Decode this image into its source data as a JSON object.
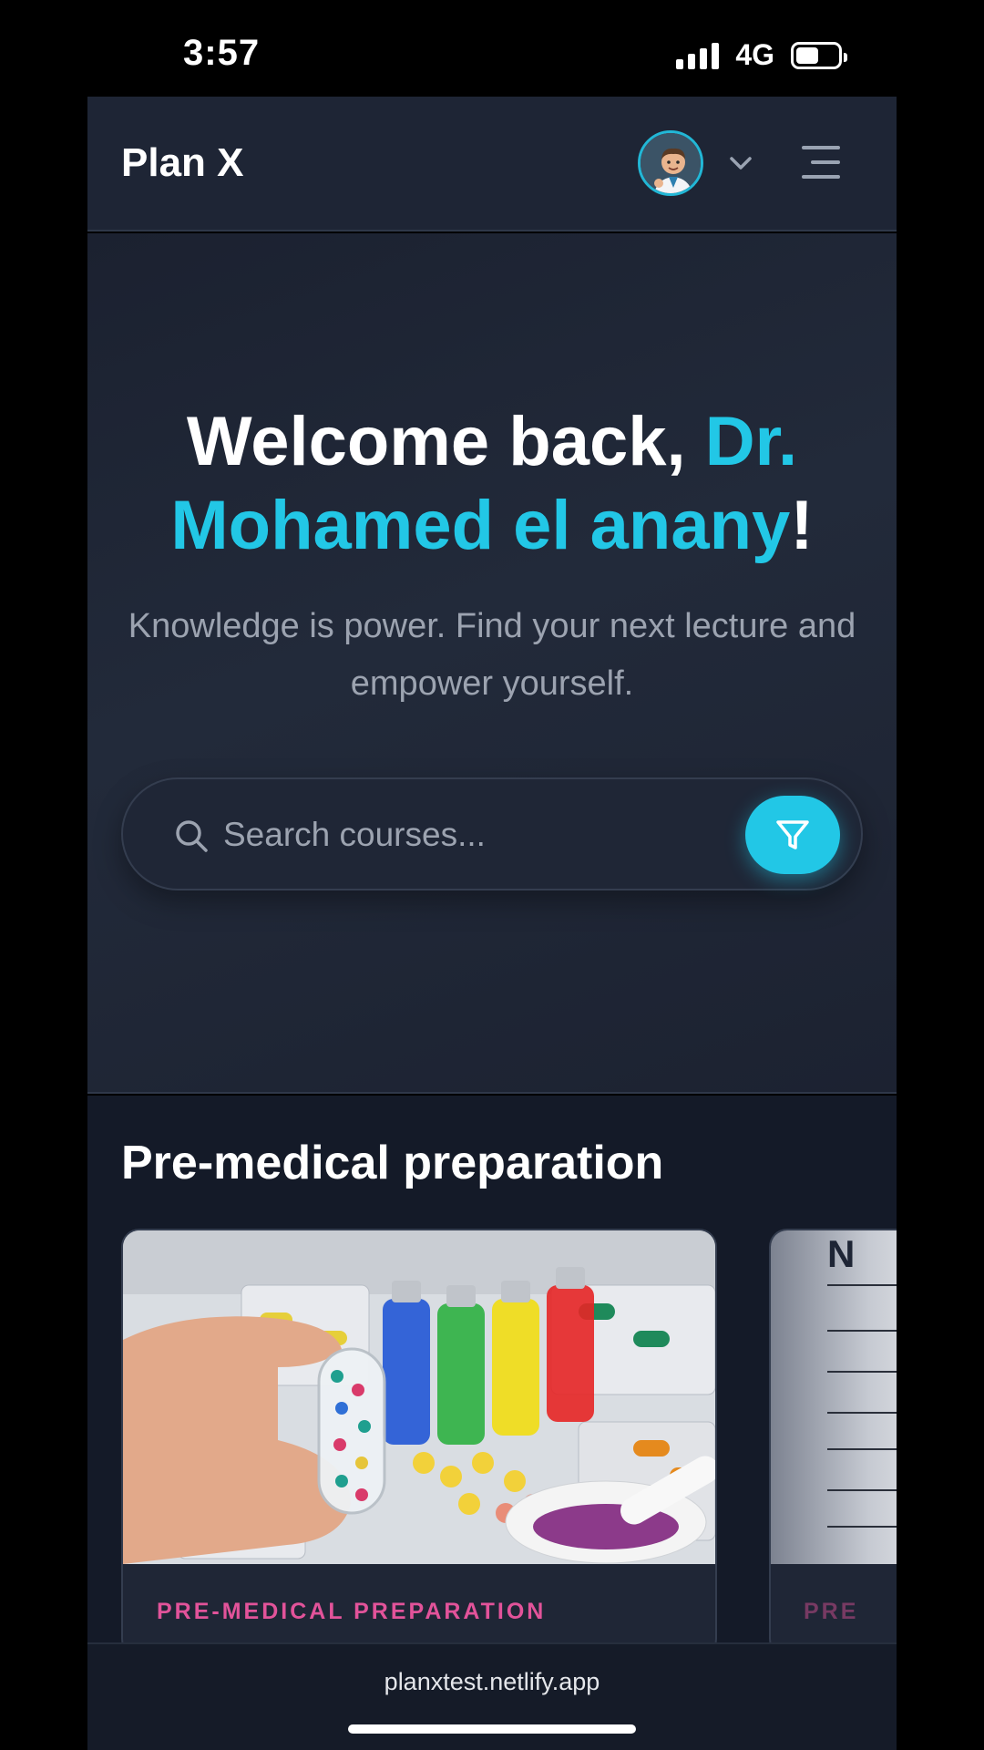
{
  "status_bar": {
    "time": "3:57",
    "network": "4G",
    "battery_level": 0.55
  },
  "header": {
    "brand": "Plan X",
    "avatar_icon": "doctor-avatar",
    "menu_icon": "hamburger-icon"
  },
  "hero": {
    "greeting_prefix": "Welcome back, ",
    "user_name": "Dr. Mohamed el anany",
    "greeting_suffix": "!",
    "subtitle": "Knowledge is power. Find your next lecture and empower yourself.",
    "search_placeholder": "Search courses...",
    "accent_color": "#22c7e6"
  },
  "section": {
    "title": "Pre-medical preparation",
    "cards": [
      {
        "category": "PRE-MEDICAL PREPARATION"
      },
      {
        "category": "PRE"
      }
    ]
  },
  "browser": {
    "url": "planxtest.netlify.app"
  },
  "colors": {
    "category": "#e2539a",
    "background": "#1e2535"
  }
}
